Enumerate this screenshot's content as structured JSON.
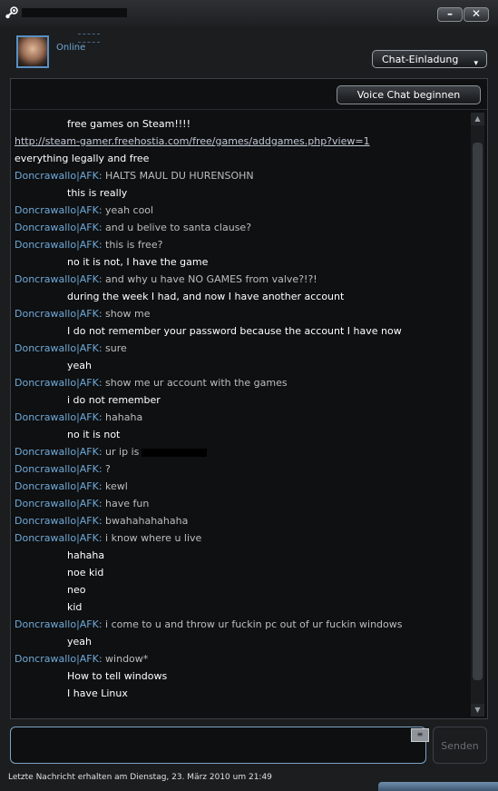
{
  "window": {
    "minimize": "–",
    "close": "✕",
    "icon": "steam-icon"
  },
  "header": {
    "presence": "Online",
    "invite_button": "Chat-Einladung",
    "invite_caret": "▾"
  },
  "voice_button": "Voice Chat beginnen",
  "messages": [
    {
      "type": "self",
      "text": "free games on Steam!!!!"
    },
    {
      "type": "link",
      "text": "http://steam-gamer.freehostia.com/free/games/addgames.php?view=1"
    },
    {
      "type": "plain",
      "text": "everything legally and free"
    },
    {
      "type": "other",
      "sender": "Doncrawallo|AFK:",
      "text": "HALTS MAUL DU HURENSOHN"
    },
    {
      "type": "self",
      "text": "this is really"
    },
    {
      "type": "other",
      "sender": "Doncrawallo|AFK:",
      "text": "yeah cool"
    },
    {
      "type": "other",
      "sender": "Doncrawallo|AFK:",
      "text": "and u belive to santa clause?"
    },
    {
      "type": "other",
      "sender": "Doncrawallo|AFK:",
      "text": "this is free?"
    },
    {
      "type": "self",
      "text": "no it is not, I have the game"
    },
    {
      "type": "other",
      "sender": "Doncrawallo|AFK:",
      "text": "and why u have NO GAMES from valve?!?!"
    },
    {
      "type": "self",
      "text": "during the week I had, and now I have another account"
    },
    {
      "type": "other",
      "sender": "Doncrawallo|AFK:",
      "text": "show me"
    },
    {
      "type": "self",
      "text": "I do not remember your password because the account I have now"
    },
    {
      "type": "other",
      "sender": "Doncrawallo|AFK:",
      "text": "sure"
    },
    {
      "type": "self",
      "text": "yeah"
    },
    {
      "type": "other",
      "sender": "Doncrawallo|AFK:",
      "text": "show me ur account with the games"
    },
    {
      "type": "self",
      "text": "i do not remember"
    },
    {
      "type": "other",
      "sender": "Doncrawallo|AFK:",
      "text": "hahaha"
    },
    {
      "type": "self",
      "text": "no it is not"
    },
    {
      "type": "other",
      "sender": "Doncrawallo|AFK:",
      "text": "ur ip is",
      "redacted": true
    },
    {
      "type": "other",
      "sender": "Doncrawallo|AFK:",
      "text": "?"
    },
    {
      "type": "other",
      "sender": "Doncrawallo|AFK:",
      "text": "kewl"
    },
    {
      "type": "other",
      "sender": "Doncrawallo|AFK:",
      "text": "have fun"
    },
    {
      "type": "other",
      "sender": "Doncrawallo|AFK:",
      "text": "bwahahahahaha"
    },
    {
      "type": "other",
      "sender": "Doncrawallo|AFK:",
      "text": "i know where u live"
    },
    {
      "type": "self",
      "text": "hahaha"
    },
    {
      "type": "self",
      "text": "noe kid"
    },
    {
      "type": "self",
      "text": "neo"
    },
    {
      "type": "self",
      "text": "kid"
    },
    {
      "type": "other",
      "sender": "Doncrawallo|AFK:",
      "text": "i come to u and throw ur fuckin pc out of ur fuckin windows"
    },
    {
      "type": "self",
      "text": "yeah"
    },
    {
      "type": "other",
      "sender": "Doncrawallo|AFK:",
      "text": "window*"
    },
    {
      "type": "self",
      "text": "How to tell windows"
    },
    {
      "type": "self",
      "text": "I have Linux"
    }
  ],
  "compose": {
    "send_button": "Senden",
    "emote_label": "≡"
  },
  "status": "Letzte Nachricht erhalten am Dienstag, 23. März 2010 um 21:49",
  "colors": {
    "sender": "#6ea9d9",
    "self_text": "#ffffff",
    "other_text": "#bdbdbd",
    "background": "#1b1d1f"
  }
}
